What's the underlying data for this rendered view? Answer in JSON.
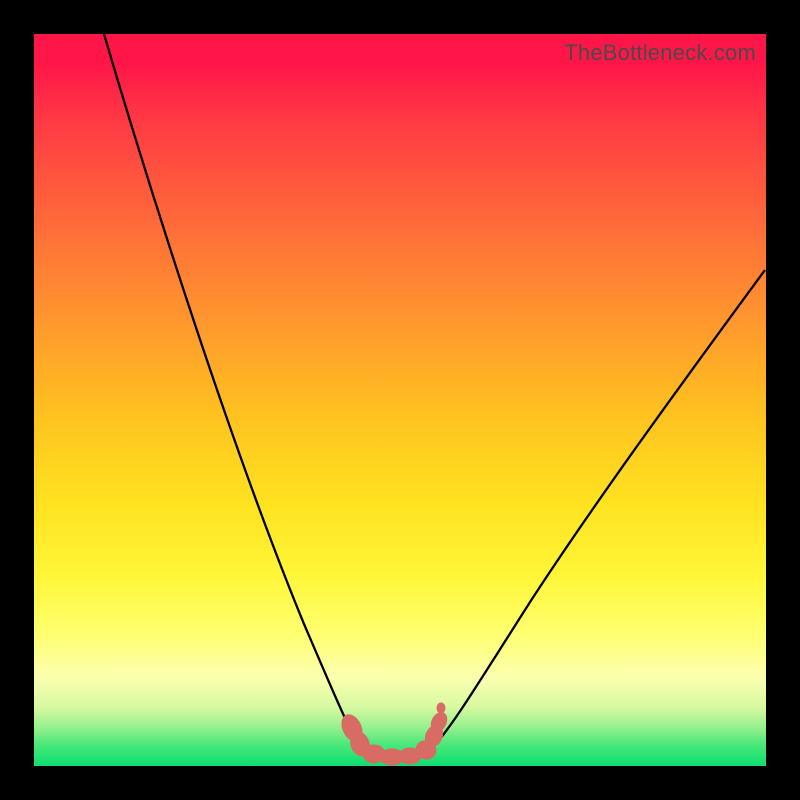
{
  "watermark": "TheBottleneck.com",
  "chart_data": {
    "type": "line",
    "title": "",
    "xlabel": "",
    "ylabel": "",
    "xlim": [
      0,
      100
    ],
    "ylim": [
      0,
      100
    ],
    "series": [
      {
        "name": "bottleneck-curve",
        "x": [
          10,
          15,
          20,
          25,
          30,
          35,
          38,
          41,
          43,
          44,
          45,
          47,
          49,
          51,
          53,
          55,
          58,
          62,
          68,
          75,
          83,
          92,
          100
        ],
        "y": [
          100,
          88,
          76,
          63,
          50,
          35,
          24,
          14,
          7,
          4,
          2.5,
          2,
          2,
          2,
          3,
          5,
          10,
          18,
          28,
          38,
          48,
          58,
          68
        ]
      }
    ],
    "annotations": [
      {
        "name": "trough-marker",
        "type": "blob",
        "x_range": [
          43,
          55
        ],
        "y_range": [
          2,
          5
        ],
        "color": "#d86b63"
      }
    ],
    "gradient_background": true
  }
}
